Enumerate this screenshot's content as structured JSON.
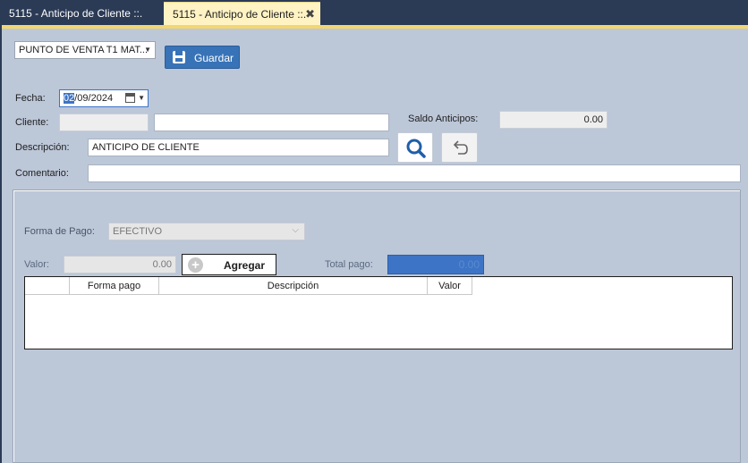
{
  "tabs": [
    {
      "label": "5115 - Anticipo de Cliente ::."
    },
    {
      "label": "5115 - Anticipo de Cliente ::."
    }
  ],
  "tab_close_symbol": "✖",
  "toolbar": {
    "store_select_value": "PUNTO DE VENTA T1 MAT...",
    "save_label": "Guardar"
  },
  "form": {
    "fecha_label": "Fecha:",
    "fecha_day": "02",
    "fecha_rest": "/09/2024",
    "cliente_label": "Cliente:",
    "cliente_code": "",
    "cliente_name": "",
    "saldo_label": "Saldo Anticipos:",
    "saldo_value": "0.00",
    "descripcion_label": "Descripción:",
    "descripcion_value": "ANTICIPO DE CLIENTE",
    "comentario_label": "Comentario:",
    "comentario_value": ""
  },
  "payment": {
    "forma_label": "Forma de Pago:",
    "forma_value": "EFECTIVO",
    "valor_label": "Valor:",
    "valor_value": "0.00",
    "add_label": "Agregar",
    "total_label": "Total pago:",
    "total_value": "0.00"
  },
  "grid": {
    "columns": [
      "",
      "Forma pago",
      "Descripción",
      "Valor"
    ]
  },
  "colors": {
    "accent_blue": "#3873b7",
    "tab_active_bg": "#fff3c4",
    "panel_bg": "#bcc7d8",
    "frame_bg": "#2b3a55"
  },
  "icons": {
    "save": "floppy-disk-icon",
    "search": "search-icon",
    "undo": "undo-arrow-icon",
    "calendar": "calendar-icon",
    "add": "plus-circle-icon"
  }
}
